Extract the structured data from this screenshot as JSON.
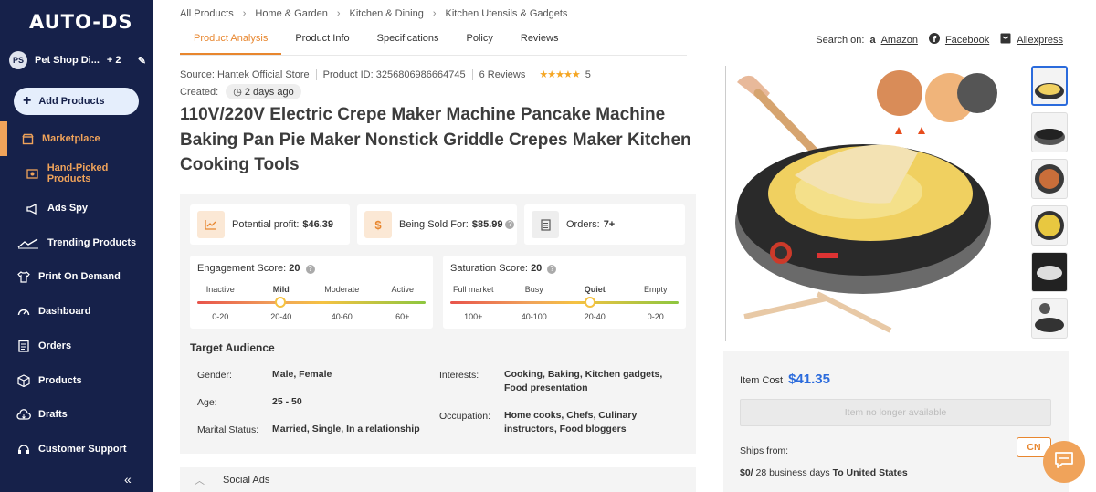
{
  "sidebar": {
    "logo": "AUTO-DS",
    "store": {
      "initials": "PS",
      "name": "Pet Shop Di...",
      "extra": "+ 2"
    },
    "add_products": "Add Products",
    "items": [
      {
        "label": "Marketplace",
        "icon": "store-icon"
      },
      {
        "label": "Hand-Picked Products",
        "icon": "hand-picked-icon"
      },
      {
        "label": "Ads Spy",
        "icon": "megaphone-icon"
      },
      {
        "label": "Trending Products",
        "icon": "trending-icon"
      },
      {
        "label": "Print On Demand",
        "icon": "shirt-icon"
      },
      {
        "label": "Dashboard",
        "icon": "gauge-icon"
      },
      {
        "label": "Orders",
        "icon": "clipboard-icon"
      },
      {
        "label": "Products",
        "icon": "box-icon"
      },
      {
        "label": "Drafts",
        "icon": "cloud-icon"
      },
      {
        "label": "Customer Support",
        "icon": "headset-icon"
      }
    ],
    "collapse": "«"
  },
  "breadcrumb": [
    "All Products",
    "Home & Garden",
    "Kitchen & Dining",
    "Kitchen Utensils & Gadgets"
  ],
  "tabs": [
    "Product Analysis",
    "Product Info",
    "Specifications",
    "Policy",
    "Reviews"
  ],
  "search_on": {
    "label": "Search on:",
    "links": [
      "Amazon",
      "Facebook",
      "Aliexpress"
    ]
  },
  "meta": {
    "source": "Source: Hantek Official Store",
    "product_id": "Product ID: 3256806986664745",
    "reviews": "6 Reviews",
    "stars": "★★★★★",
    "rating": "5",
    "created_label": "Created:",
    "created_value": "2 days ago"
  },
  "title": "110V/220V Electric Crepe Maker Machine Pancake Machine Baking Pan Pie Maker Nonstick Griddle Crepes Maker Kitchen Cooking Tools",
  "stats": {
    "profit_label": "Potential profit:",
    "profit_value": "$46.39",
    "sold_label": "Being Sold For:",
    "sold_value": "$85.99",
    "orders_label": "Orders:",
    "orders_value": "7+"
  },
  "engagement": {
    "label": "Engagement Score:",
    "value": "20",
    "levels": [
      "Inactive",
      "Mild",
      "Moderate",
      "Active"
    ],
    "ranges": [
      "0-20",
      "20-40",
      "40-60",
      "60+"
    ]
  },
  "saturation": {
    "label": "Saturation Score:",
    "value": "20",
    "levels": [
      "Full market",
      "Busy",
      "Quiet",
      "Empty"
    ],
    "ranges": [
      "100+",
      "40-100",
      "20-40",
      "0-20"
    ]
  },
  "audience": {
    "title": "Target Audience",
    "gender_label": "Gender:",
    "gender": "Male, Female",
    "age_label": "Age:",
    "age": "25 - 50",
    "marital_label": "Marital Status:",
    "marital": "Married, Single, In a relationship",
    "interests_label": "Interests:",
    "interests": "Cooking, Baking, Kitchen gadgets, Food presentation",
    "occupation_label": "Occupation:",
    "occupation": "Home cooks, Chefs, Culinary instructors, Food bloggers"
  },
  "social_ads": "Social Ads",
  "buy": {
    "cost_label": "Item Cost",
    "cost": "$41.35",
    "unavailable": "Item no longer available",
    "ships_from": "Ships from:",
    "country": "CN",
    "ship_price": "$0/",
    "ship_days": "28 business days",
    "ship_to": "To United States"
  }
}
